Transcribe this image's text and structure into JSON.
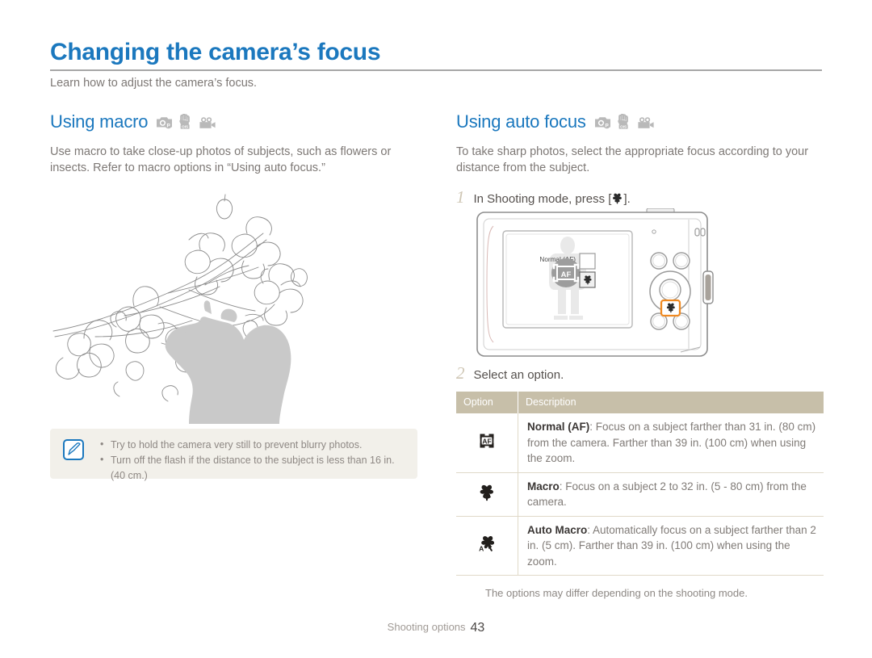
{
  "document": {
    "title": "Changing the camera’s focus",
    "subtitle": "Learn how to adjust the camera’s focus.",
    "footer_label": "Shooting options",
    "page_number": "43",
    "accent_color": "#1b78be",
    "rule_color": "#a7a7a7",
    "table_header_color": "#c7bfa9"
  },
  "left_column": {
    "heading": "Using macro",
    "mode_icons": [
      "camera-p-mode-icon",
      "hand-ois-icon",
      "video-camera-icon"
    ],
    "body": "Use macro to take close-up photos of subjects, such as flowers or insects. Refer to macro options in “Using auto focus.”",
    "illustration": "macro-flowers-photographer-illustration"
  },
  "note_box": {
    "icon": "note-pen-icon",
    "items": [
      "Try to hold the camera very still to prevent blurry photos.",
      "Turn off the flash if the distance to the subject is less than 16 in. (40 cm.)"
    ]
  },
  "right_column": {
    "heading": "Using auto focus",
    "mode_icons": [
      "camera-p-mode-icon",
      "hand-ois-icon",
      "video-camera-icon"
    ],
    "body": "To take sharp photos, select the appropriate focus according to your distance from the subject.",
    "steps": [
      {
        "number": "1",
        "text_before": "In Shooting mode, press [",
        "key_icon": "macro-flower-icon",
        "text_after": "]."
      },
      {
        "number": "2",
        "text_before": "Select an option.",
        "key_icon": "",
        "text_after": ""
      }
    ],
    "camera_illustration": {
      "name": "camera-back-illustration",
      "screen_label": "Normal (AF)",
      "screen_icon_selected": "af-frame-icon",
      "screen_icon_option": "macro-flower-icon",
      "highlighted_button": "macro-button-highlight",
      "highlight_color": "#f08a22"
    },
    "table": {
      "headers": [
        "Option",
        "Description"
      ],
      "rows": [
        {
          "icon": "af-frame-icon",
          "title": "Normal (AF)",
          "description": ": Focus on a subject farther than 31 in. (80 cm) from the camera. Farther than 39 in. (100 cm) when using the zoom."
        },
        {
          "icon": "macro-flower-icon",
          "title": "Macro",
          "description": ": Focus on a subject 2 to 32 in. (5 - 80 cm) from the camera."
        },
        {
          "icon": "auto-macro-flower-icon",
          "title": "Auto Macro",
          "description": ": Automatically focus on a subject farther than 2 in. (5 cm). Farther than 39 in. (100 cm) when using the zoom."
        }
      ],
      "footnote": "The options may differ depending on the shooting mode."
    }
  }
}
